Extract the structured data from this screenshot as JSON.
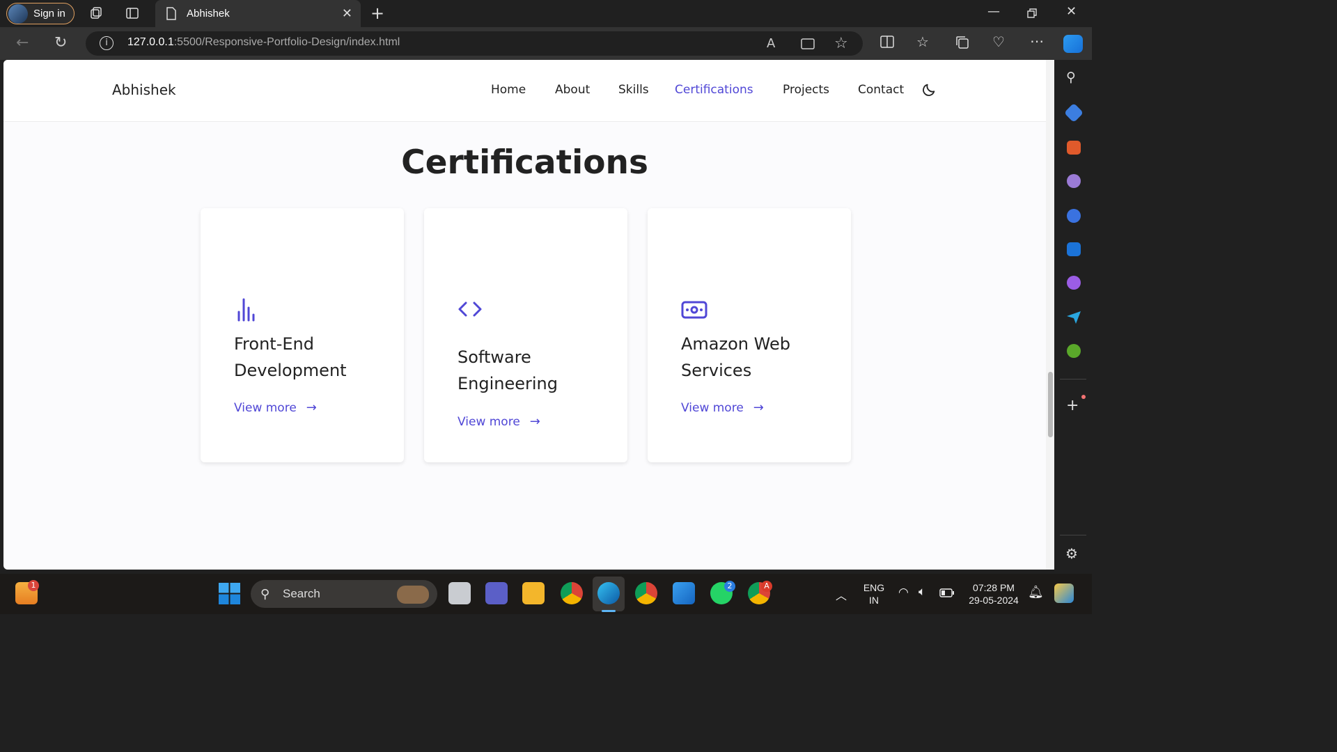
{
  "browser": {
    "signin_label": "Sign in",
    "tab_title": "Abhishek",
    "url_host": "127.0.0.1",
    "url_rest": ":5500/Responsive-Portfolio-Design/index.html"
  },
  "site": {
    "logo": "Abhishek",
    "nav": [
      {
        "label": "Home"
      },
      {
        "label": "About"
      },
      {
        "label": "Skills"
      },
      {
        "label": "Certifications",
        "active": true
      },
      {
        "label": "Projects"
      },
      {
        "label": "Contact"
      }
    ]
  },
  "section": {
    "title": "Certifications",
    "cards": [
      {
        "icon": "bar-chart-icon",
        "title": "Front-End Development",
        "link": "View more"
      },
      {
        "icon": "code-icon",
        "title": "Software Engineering",
        "link": "View more"
      },
      {
        "icon": "money-icon",
        "title": "Amazon Web Services",
        "link": "View more"
      }
    ]
  },
  "taskbar": {
    "search_label": "Search",
    "lang_line1": "ENG",
    "lang_line2": "IN",
    "time": "07:28 PM",
    "date": "29-05-2024",
    "badges": {
      "widgets": "1",
      "whatsapp": "2",
      "chrome_profile": "A"
    }
  },
  "colors": {
    "accent": "#5047d6",
    "text": "#222222"
  }
}
